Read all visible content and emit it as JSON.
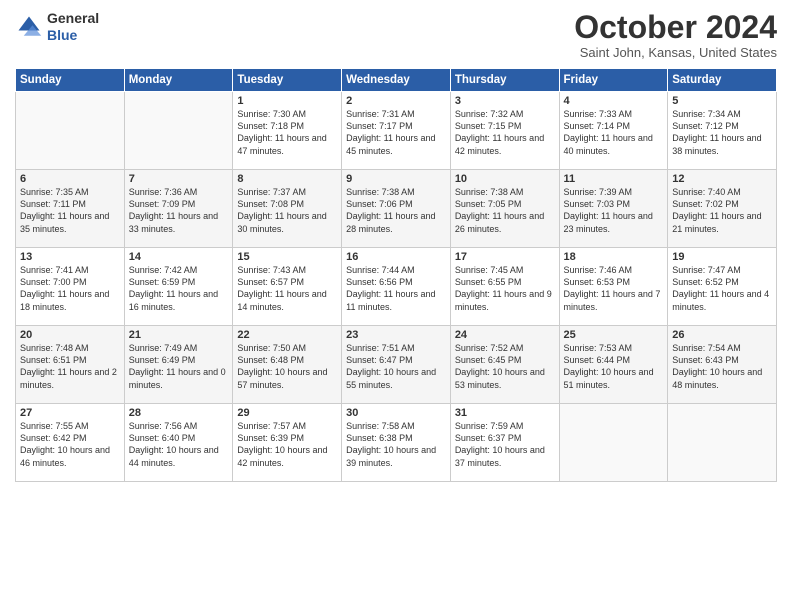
{
  "header": {
    "logo_line1": "General",
    "logo_line2": "Blue",
    "month_title": "October 2024",
    "subtitle": "Saint John, Kansas, United States"
  },
  "days_of_week": [
    "Sunday",
    "Monday",
    "Tuesday",
    "Wednesday",
    "Thursday",
    "Friday",
    "Saturday"
  ],
  "weeks": [
    [
      {
        "day": "",
        "info": ""
      },
      {
        "day": "",
        "info": ""
      },
      {
        "day": "1",
        "info": "Sunrise: 7:30 AM\nSunset: 7:18 PM\nDaylight: 11 hours and 47 minutes."
      },
      {
        "day": "2",
        "info": "Sunrise: 7:31 AM\nSunset: 7:17 PM\nDaylight: 11 hours and 45 minutes."
      },
      {
        "day": "3",
        "info": "Sunrise: 7:32 AM\nSunset: 7:15 PM\nDaylight: 11 hours and 42 minutes."
      },
      {
        "day": "4",
        "info": "Sunrise: 7:33 AM\nSunset: 7:14 PM\nDaylight: 11 hours and 40 minutes."
      },
      {
        "day": "5",
        "info": "Sunrise: 7:34 AM\nSunset: 7:12 PM\nDaylight: 11 hours and 38 minutes."
      }
    ],
    [
      {
        "day": "6",
        "info": "Sunrise: 7:35 AM\nSunset: 7:11 PM\nDaylight: 11 hours and 35 minutes."
      },
      {
        "day": "7",
        "info": "Sunrise: 7:36 AM\nSunset: 7:09 PM\nDaylight: 11 hours and 33 minutes."
      },
      {
        "day": "8",
        "info": "Sunrise: 7:37 AM\nSunset: 7:08 PM\nDaylight: 11 hours and 30 minutes."
      },
      {
        "day": "9",
        "info": "Sunrise: 7:38 AM\nSunset: 7:06 PM\nDaylight: 11 hours and 28 minutes."
      },
      {
        "day": "10",
        "info": "Sunrise: 7:38 AM\nSunset: 7:05 PM\nDaylight: 11 hours and 26 minutes."
      },
      {
        "day": "11",
        "info": "Sunrise: 7:39 AM\nSunset: 7:03 PM\nDaylight: 11 hours and 23 minutes."
      },
      {
        "day": "12",
        "info": "Sunrise: 7:40 AM\nSunset: 7:02 PM\nDaylight: 11 hours and 21 minutes."
      }
    ],
    [
      {
        "day": "13",
        "info": "Sunrise: 7:41 AM\nSunset: 7:00 PM\nDaylight: 11 hours and 18 minutes."
      },
      {
        "day": "14",
        "info": "Sunrise: 7:42 AM\nSunset: 6:59 PM\nDaylight: 11 hours and 16 minutes."
      },
      {
        "day": "15",
        "info": "Sunrise: 7:43 AM\nSunset: 6:57 PM\nDaylight: 11 hours and 14 minutes."
      },
      {
        "day": "16",
        "info": "Sunrise: 7:44 AM\nSunset: 6:56 PM\nDaylight: 11 hours and 11 minutes."
      },
      {
        "day": "17",
        "info": "Sunrise: 7:45 AM\nSunset: 6:55 PM\nDaylight: 11 hours and 9 minutes."
      },
      {
        "day": "18",
        "info": "Sunrise: 7:46 AM\nSunset: 6:53 PM\nDaylight: 11 hours and 7 minutes."
      },
      {
        "day": "19",
        "info": "Sunrise: 7:47 AM\nSunset: 6:52 PM\nDaylight: 11 hours and 4 minutes."
      }
    ],
    [
      {
        "day": "20",
        "info": "Sunrise: 7:48 AM\nSunset: 6:51 PM\nDaylight: 11 hours and 2 minutes."
      },
      {
        "day": "21",
        "info": "Sunrise: 7:49 AM\nSunset: 6:49 PM\nDaylight: 11 hours and 0 minutes."
      },
      {
        "day": "22",
        "info": "Sunrise: 7:50 AM\nSunset: 6:48 PM\nDaylight: 10 hours and 57 minutes."
      },
      {
        "day": "23",
        "info": "Sunrise: 7:51 AM\nSunset: 6:47 PM\nDaylight: 10 hours and 55 minutes."
      },
      {
        "day": "24",
        "info": "Sunrise: 7:52 AM\nSunset: 6:45 PM\nDaylight: 10 hours and 53 minutes."
      },
      {
        "day": "25",
        "info": "Sunrise: 7:53 AM\nSunset: 6:44 PM\nDaylight: 10 hours and 51 minutes."
      },
      {
        "day": "26",
        "info": "Sunrise: 7:54 AM\nSunset: 6:43 PM\nDaylight: 10 hours and 48 minutes."
      }
    ],
    [
      {
        "day": "27",
        "info": "Sunrise: 7:55 AM\nSunset: 6:42 PM\nDaylight: 10 hours and 46 minutes."
      },
      {
        "day": "28",
        "info": "Sunrise: 7:56 AM\nSunset: 6:40 PM\nDaylight: 10 hours and 44 minutes."
      },
      {
        "day": "29",
        "info": "Sunrise: 7:57 AM\nSunset: 6:39 PM\nDaylight: 10 hours and 42 minutes."
      },
      {
        "day": "30",
        "info": "Sunrise: 7:58 AM\nSunset: 6:38 PM\nDaylight: 10 hours and 39 minutes."
      },
      {
        "day": "31",
        "info": "Sunrise: 7:59 AM\nSunset: 6:37 PM\nDaylight: 10 hours and 37 minutes."
      },
      {
        "day": "",
        "info": ""
      },
      {
        "day": "",
        "info": ""
      }
    ]
  ]
}
